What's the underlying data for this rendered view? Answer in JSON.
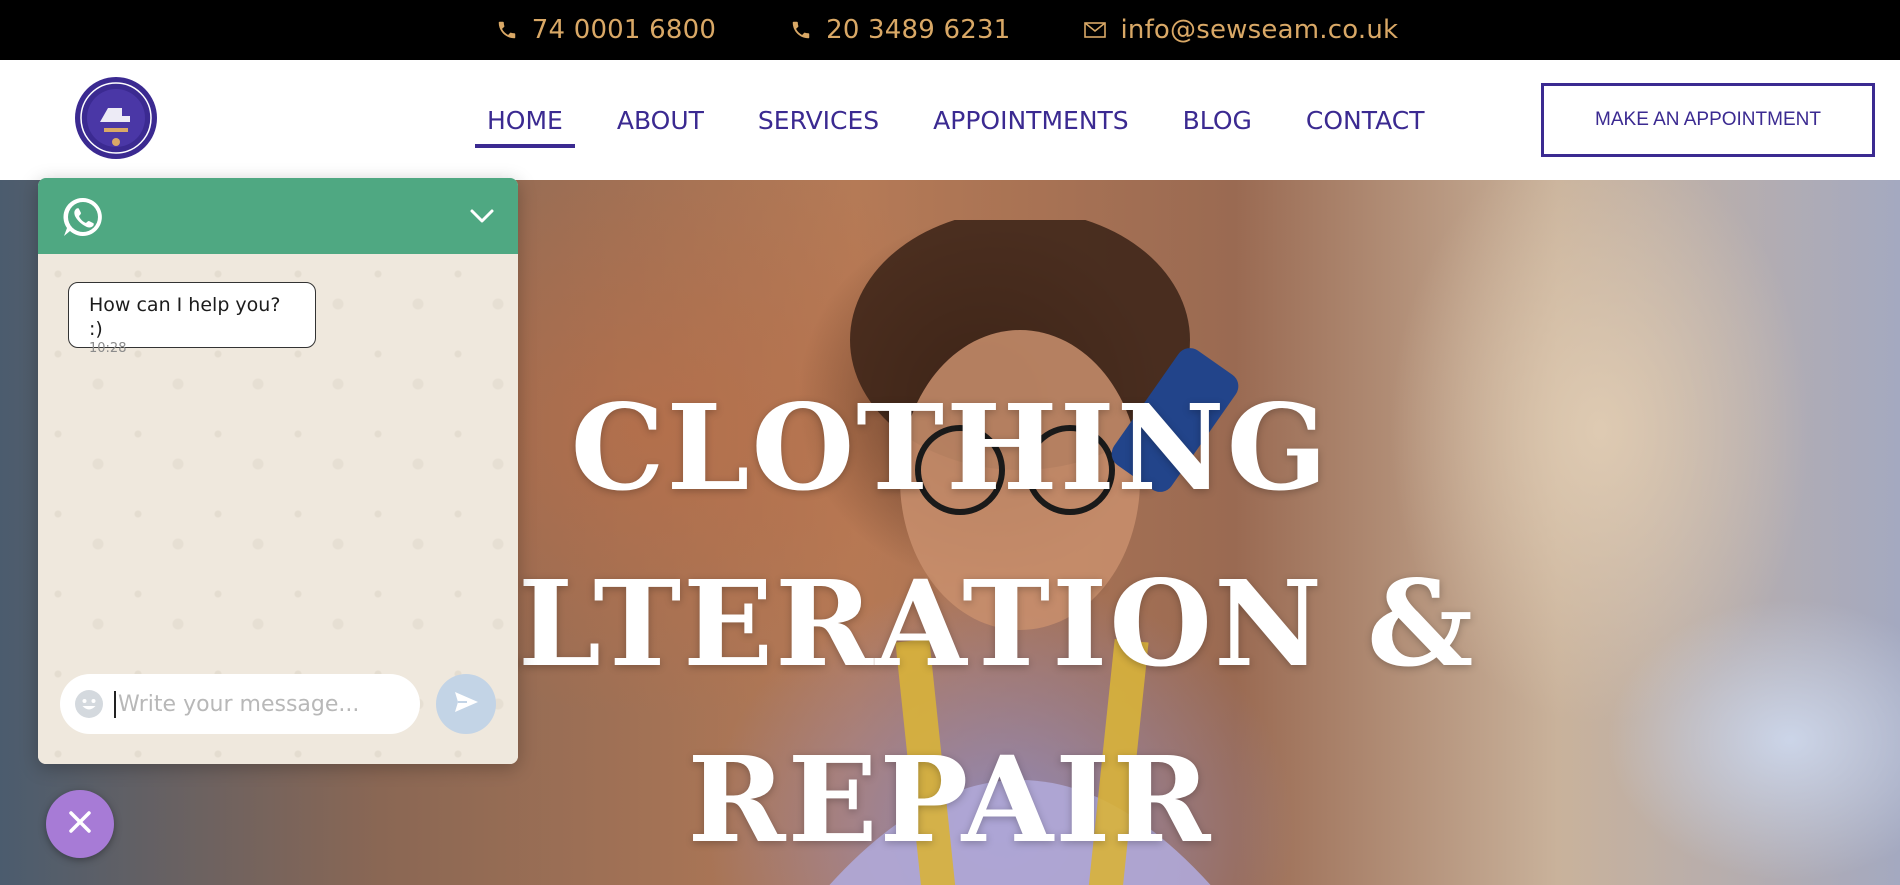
{
  "topbar": {
    "phone1": "74 0001 6800",
    "phone2": "20 3489 6231",
    "email": "info@sewseam.co.uk"
  },
  "nav": {
    "items": [
      {
        "label": "HOME",
        "active": true
      },
      {
        "label": "ABOUT"
      },
      {
        "label": "SERVICES"
      },
      {
        "label": "APPOINTMENTS"
      },
      {
        "label": "BLOG"
      },
      {
        "label": "CONTACT"
      }
    ],
    "cta_label": "MAKE AN APPOINTMENT"
  },
  "hero": {
    "title_line1": "CLOTHING",
    "title_line2": "ALTERATION &",
    "title_line3": "REPAIR"
  },
  "chat": {
    "message_text": "How can I help you? :)",
    "message_time": "10:28",
    "input_placeholder": "Write your message..."
  },
  "colors": {
    "topbar_bg": "#000000",
    "topbar_text": "#d9a866",
    "brand": "#3b2a91",
    "whatsapp_green": "#4fa882",
    "fab_purple": "#a77bd6"
  },
  "icons": {
    "phone": "phone-icon",
    "email": "mail-icon",
    "logo": "sewseam-logo",
    "whatsapp": "whatsapp-icon",
    "collapse": "chevron-down-icon",
    "emoji": "smiley-icon",
    "send": "send-icon",
    "close": "close-icon"
  }
}
